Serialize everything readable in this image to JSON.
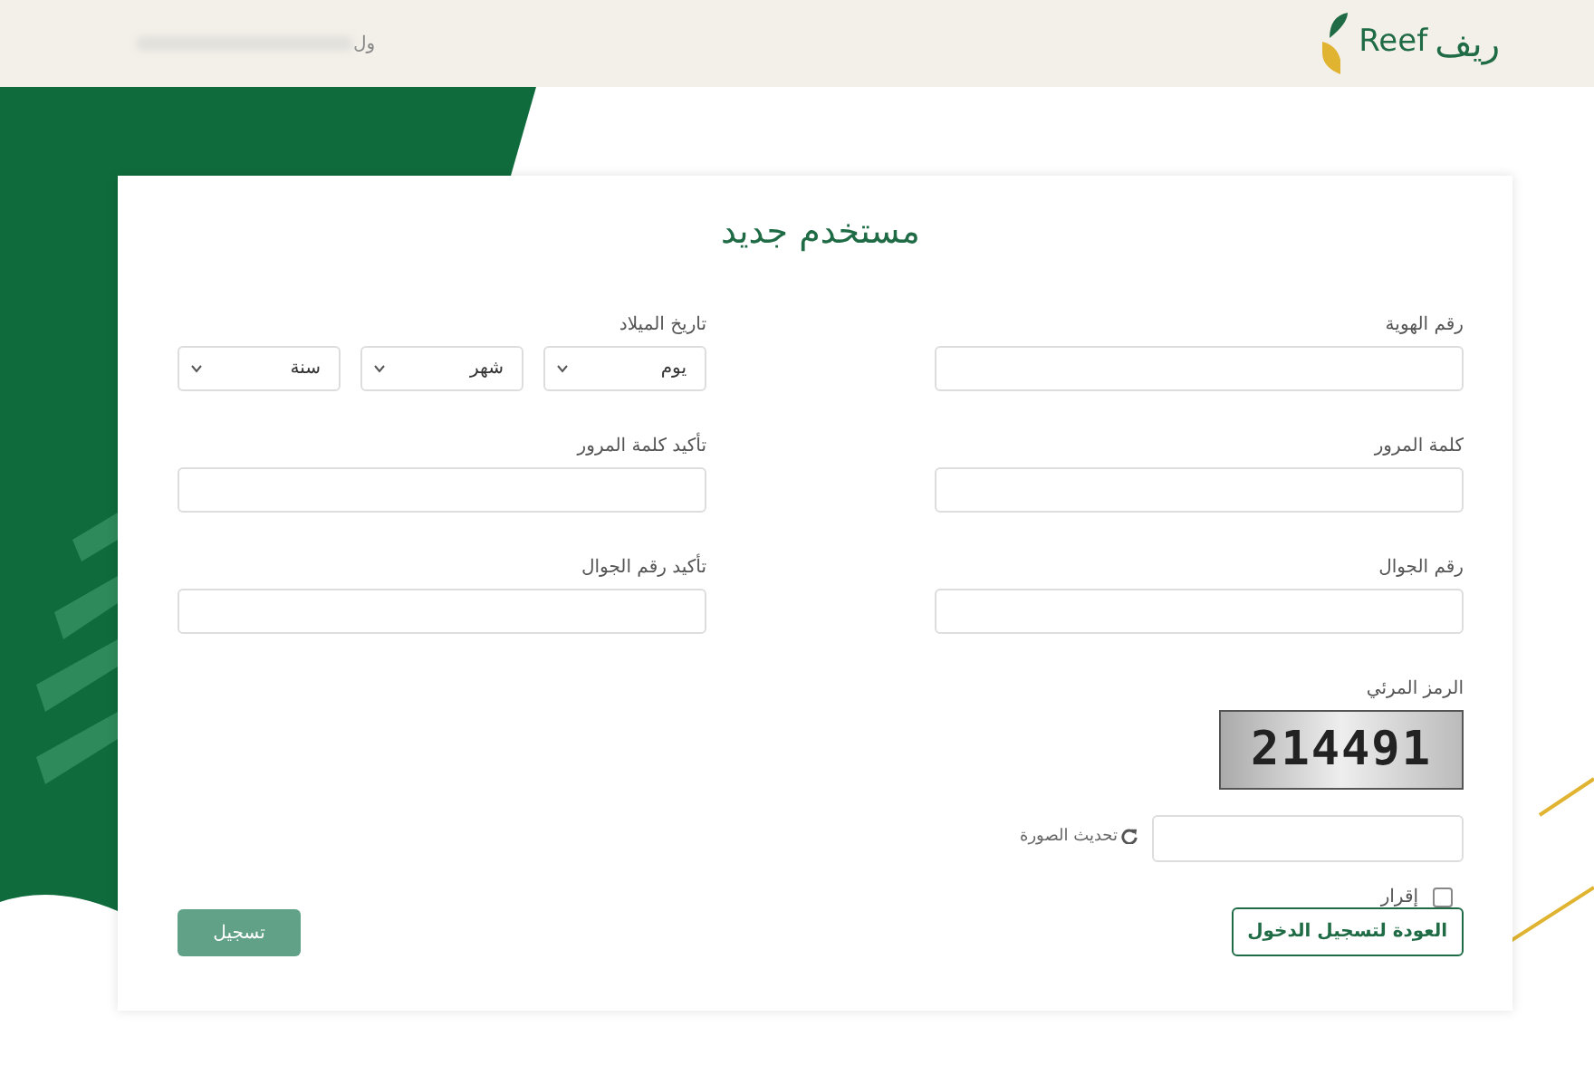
{
  "header": {
    "brand_arabic": "ريف",
    "brand_latin": "Reef",
    "user_link": "ول"
  },
  "form": {
    "title": "مستخدم جديد",
    "right_fields": [
      {
        "label": "رقم الهوية"
      },
      {
        "label": "كلمة المرور"
      },
      {
        "label": "رقم الجوال"
      }
    ],
    "birth_date": {
      "label": "تاريخ الميلاد",
      "selects": [
        {
          "value": "يوم"
        },
        {
          "value": "شهر"
        },
        {
          "value": "سنة"
        }
      ]
    },
    "left_fields": [
      {
        "label": "تأكيد كلمة المرور"
      },
      {
        "label": "تأكيد رقم الجوال"
      }
    ],
    "captcha": {
      "label": "الرمز المرئي",
      "code": "214491",
      "refresh": "تحديث الصورة"
    },
    "agreement": {
      "label": "إقرار",
      "checked": false
    },
    "back_button": "العودة لتسجيل الدخول",
    "submit_button": {
      "label": "تسجيل",
      "disabled": true
    }
  }
}
